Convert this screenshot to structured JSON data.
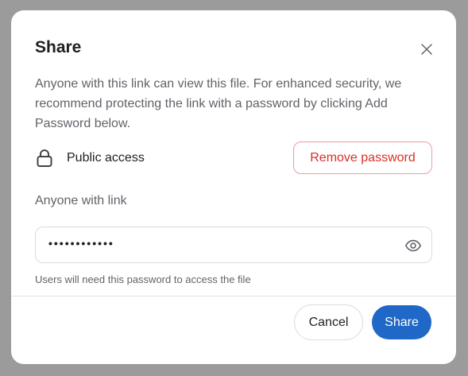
{
  "dialog": {
    "title": "Share",
    "description": "Anyone with this link can view this file. For enhanced security, we recommend protecting the link with a password by clicking Add Password below.",
    "access_label": "Public access",
    "remove_password_label": "Remove password",
    "link_label": "Anyone with link",
    "password_value": "••••••••••••",
    "password_hint": "Users will need this password to access the file",
    "cancel_label": "Cancel",
    "share_label": "Share"
  },
  "icons": {
    "close": "close-icon",
    "lock": "lock-icon",
    "eye": "eye-icon"
  },
  "colors": {
    "primary": "#1f68c7",
    "danger": "#d93025",
    "overlay": "#9b9b9b"
  }
}
